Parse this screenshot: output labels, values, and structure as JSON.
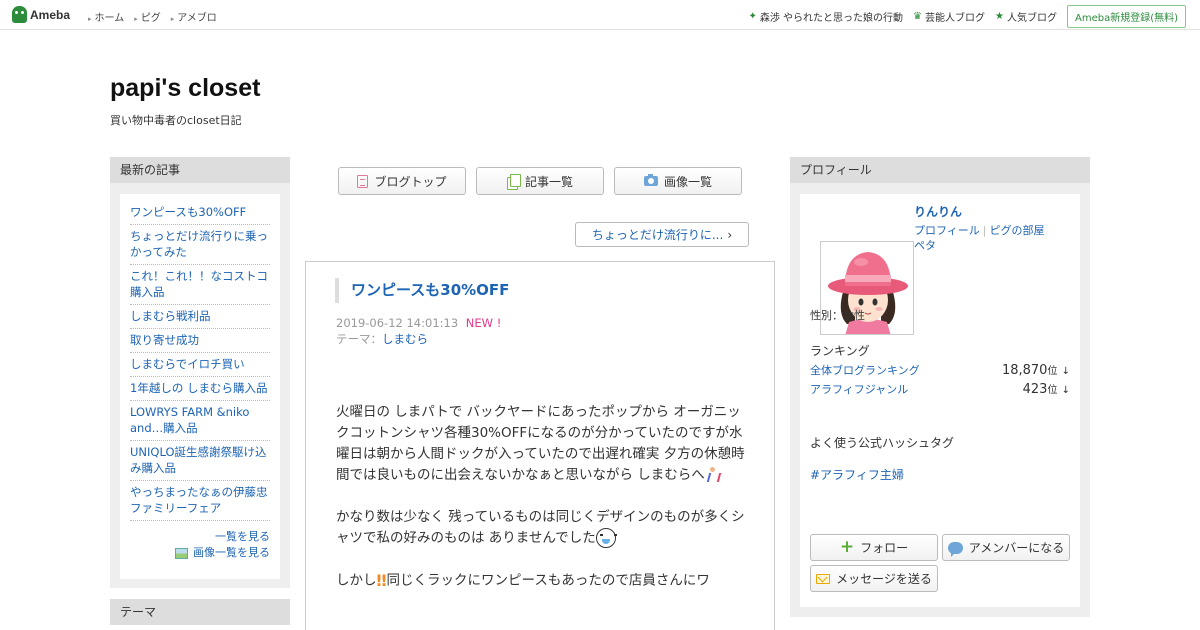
{
  "topbar": {
    "logo": "Ameba",
    "nav": [
      "ホーム",
      "ピグ",
      "アメブロ"
    ],
    "links": [
      {
        "label": "森渉 やられたと思った娘の行動",
        "icon": "sparkle-icon"
      },
      {
        "label": "芸能人ブログ",
        "icon": "crown-icon"
      },
      {
        "label": "人気ブログ",
        "icon": "star-icon"
      }
    ],
    "register": "Ameba新規登録(無料)"
  },
  "header": {
    "title": "papi's closet",
    "description": "買い物中毒者のcloset日記"
  },
  "left": {
    "recent_heading": "最新の記事",
    "recent": [
      "ワンピースも30%OFF",
      "ちょっとだけ流行りに乗っかってみた",
      "これ！これ！！なコストコ購入品",
      "しまむら戦利品",
      "取り寄せ成功",
      "しまむらでイロチ買い",
      "1年越しの しまむら購入品",
      "LOWRYS FARM &niko and…購入品",
      "UNIQLO誕生感謝祭駆け込み購入品",
      "やっちまったなぁの伊藤忠ファミリーフェア"
    ],
    "more_list": "一覧を見る",
    "more_images": "画像一覧を見る",
    "theme_heading": "テーマ"
  },
  "tabs": {
    "top": "ブログトップ",
    "list": "記事一覧",
    "images": "画像一覧"
  },
  "next_link": "ちょっとだけ流行りに...",
  "article": {
    "title": "ワンピースも30%OFF",
    "datetime": "2019-06-12 14:01:13",
    "new_label": "NEW !",
    "theme_label": "テーマ：",
    "theme": "しまむら",
    "p1": "火曜日の しまパトで バックヤードにあったポップから オーガニックコットンシャツ各種30%OFFになるのが分かっていたのですが水曜日は朝から人間ドックが入っていたので出遅れ確実 夕方の休憩時間では良いものに出会えないかなぁと思いながら しまむらへ",
    "p2": "かなり数は少なく 残っているものは同じくデザインのものが多くシャツで私の好みのものは ありませんでした",
    "p3a": "しかし",
    "p3b": "同じくラックにワンピースもあったので店員さんにワ"
  },
  "profile": {
    "heading": "プロフィール",
    "name": "りんりん",
    "link1": "プロフィール",
    "link2": "ピグの部屋",
    "link3": "ペタ",
    "gender": "性別：女性",
    "ranking_heading": "ランキング",
    "rankings": [
      {
        "label": "全体ブログランキング",
        "value": "18,870",
        "unit": "位",
        "trend": "↓"
      },
      {
        "label": "アラフィフジャンル",
        "value": "423",
        "unit": "位",
        "trend": "↓"
      }
    ],
    "hashtag_heading": "よく使う公式ハッシュタグ",
    "hashtag": "#アラフィフ主婦",
    "follow": "フォロー",
    "member": "アメンバーになる",
    "message": "メッセージを送る"
  },
  "colors": {
    "link": "#1e64b4",
    "brand": "#2d8c3c",
    "new": "#e33a8c"
  }
}
